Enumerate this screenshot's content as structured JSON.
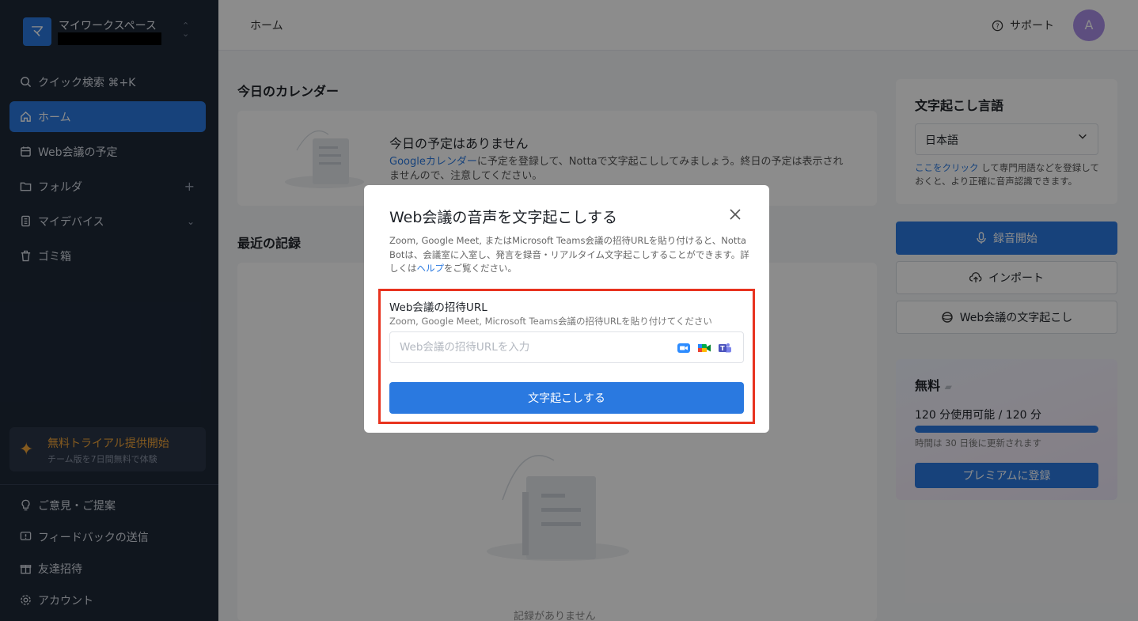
{
  "workspace": {
    "logo_letter": "マ",
    "name": "マイワークスペース"
  },
  "sidebar": {
    "items": [
      {
        "label": "クイック検索 ⌘+K"
      },
      {
        "label": "ホーム"
      },
      {
        "label": "Web会議の予定"
      },
      {
        "label": "フォルダ"
      },
      {
        "label": "マイデバイス"
      },
      {
        "label": "ゴミ箱"
      }
    ],
    "trial": {
      "title": "無料トライアル提供開始",
      "subtitle": "チーム版を7日間無料で体験"
    },
    "bottom": [
      {
        "label": "ご意見・ご提案"
      },
      {
        "label": "フィードバックの送信"
      },
      {
        "label": "友達招待"
      },
      {
        "label": "アカウント"
      }
    ]
  },
  "header": {
    "breadcrumb": "ホーム",
    "support": "サポート",
    "avatar_letter": "A"
  },
  "calendar": {
    "title": "今日のカレンダー",
    "empty_title": "今日の予定はありません",
    "desc_link": "Googleカレンダー",
    "desc_rest": "に予定を登録して、Nottaで文字起こししてみましょう。終日の予定は表示されませんので、注意してください。"
  },
  "recent": {
    "title": "最近の記録",
    "empty": "記録がありません"
  },
  "language_panel": {
    "title": "文字起こし言語",
    "selected": "日本語",
    "note_link": "ここをクリック",
    "note_rest": " して専門用語などを登録しておくと、より正確に音声認識できます。"
  },
  "actions": {
    "record": "録音開始",
    "import": "インポート",
    "web_meeting": "Web会議の文字起こし"
  },
  "plan": {
    "name": "無料",
    "usage": "120 分使用可能 / 120 分",
    "remaining_fraction": 1.0,
    "renew": "時間は 30 日後に更新されます",
    "upgrade": "プレミアムに登録"
  },
  "modal": {
    "title": "Web会議の音声を文字起こしする",
    "desc_before": "Zoom, Google Meet, またはMicrosoft Teams会議の招待URLを貼り付けると、Notta Botは、会議室に入室し、発言を録音・リアルタイム文字起こしすることができます。詳しくは",
    "desc_link": "ヘルプ",
    "desc_after": "をご覧ください。",
    "field_label": "Web会議の招待URL",
    "field_help": "Zoom, Google Meet, Microsoft Teams会議の招待URLを貼り付けてください",
    "field_value": "",
    "field_placeholder": "Web会議の招待URLを入力",
    "submit": "文字起こしする"
  },
  "colors": {
    "accent": "#2a79e0",
    "sidebar_bg": "#1e2838",
    "highlight": "#e8331f",
    "trial": "#f0a43a"
  }
}
